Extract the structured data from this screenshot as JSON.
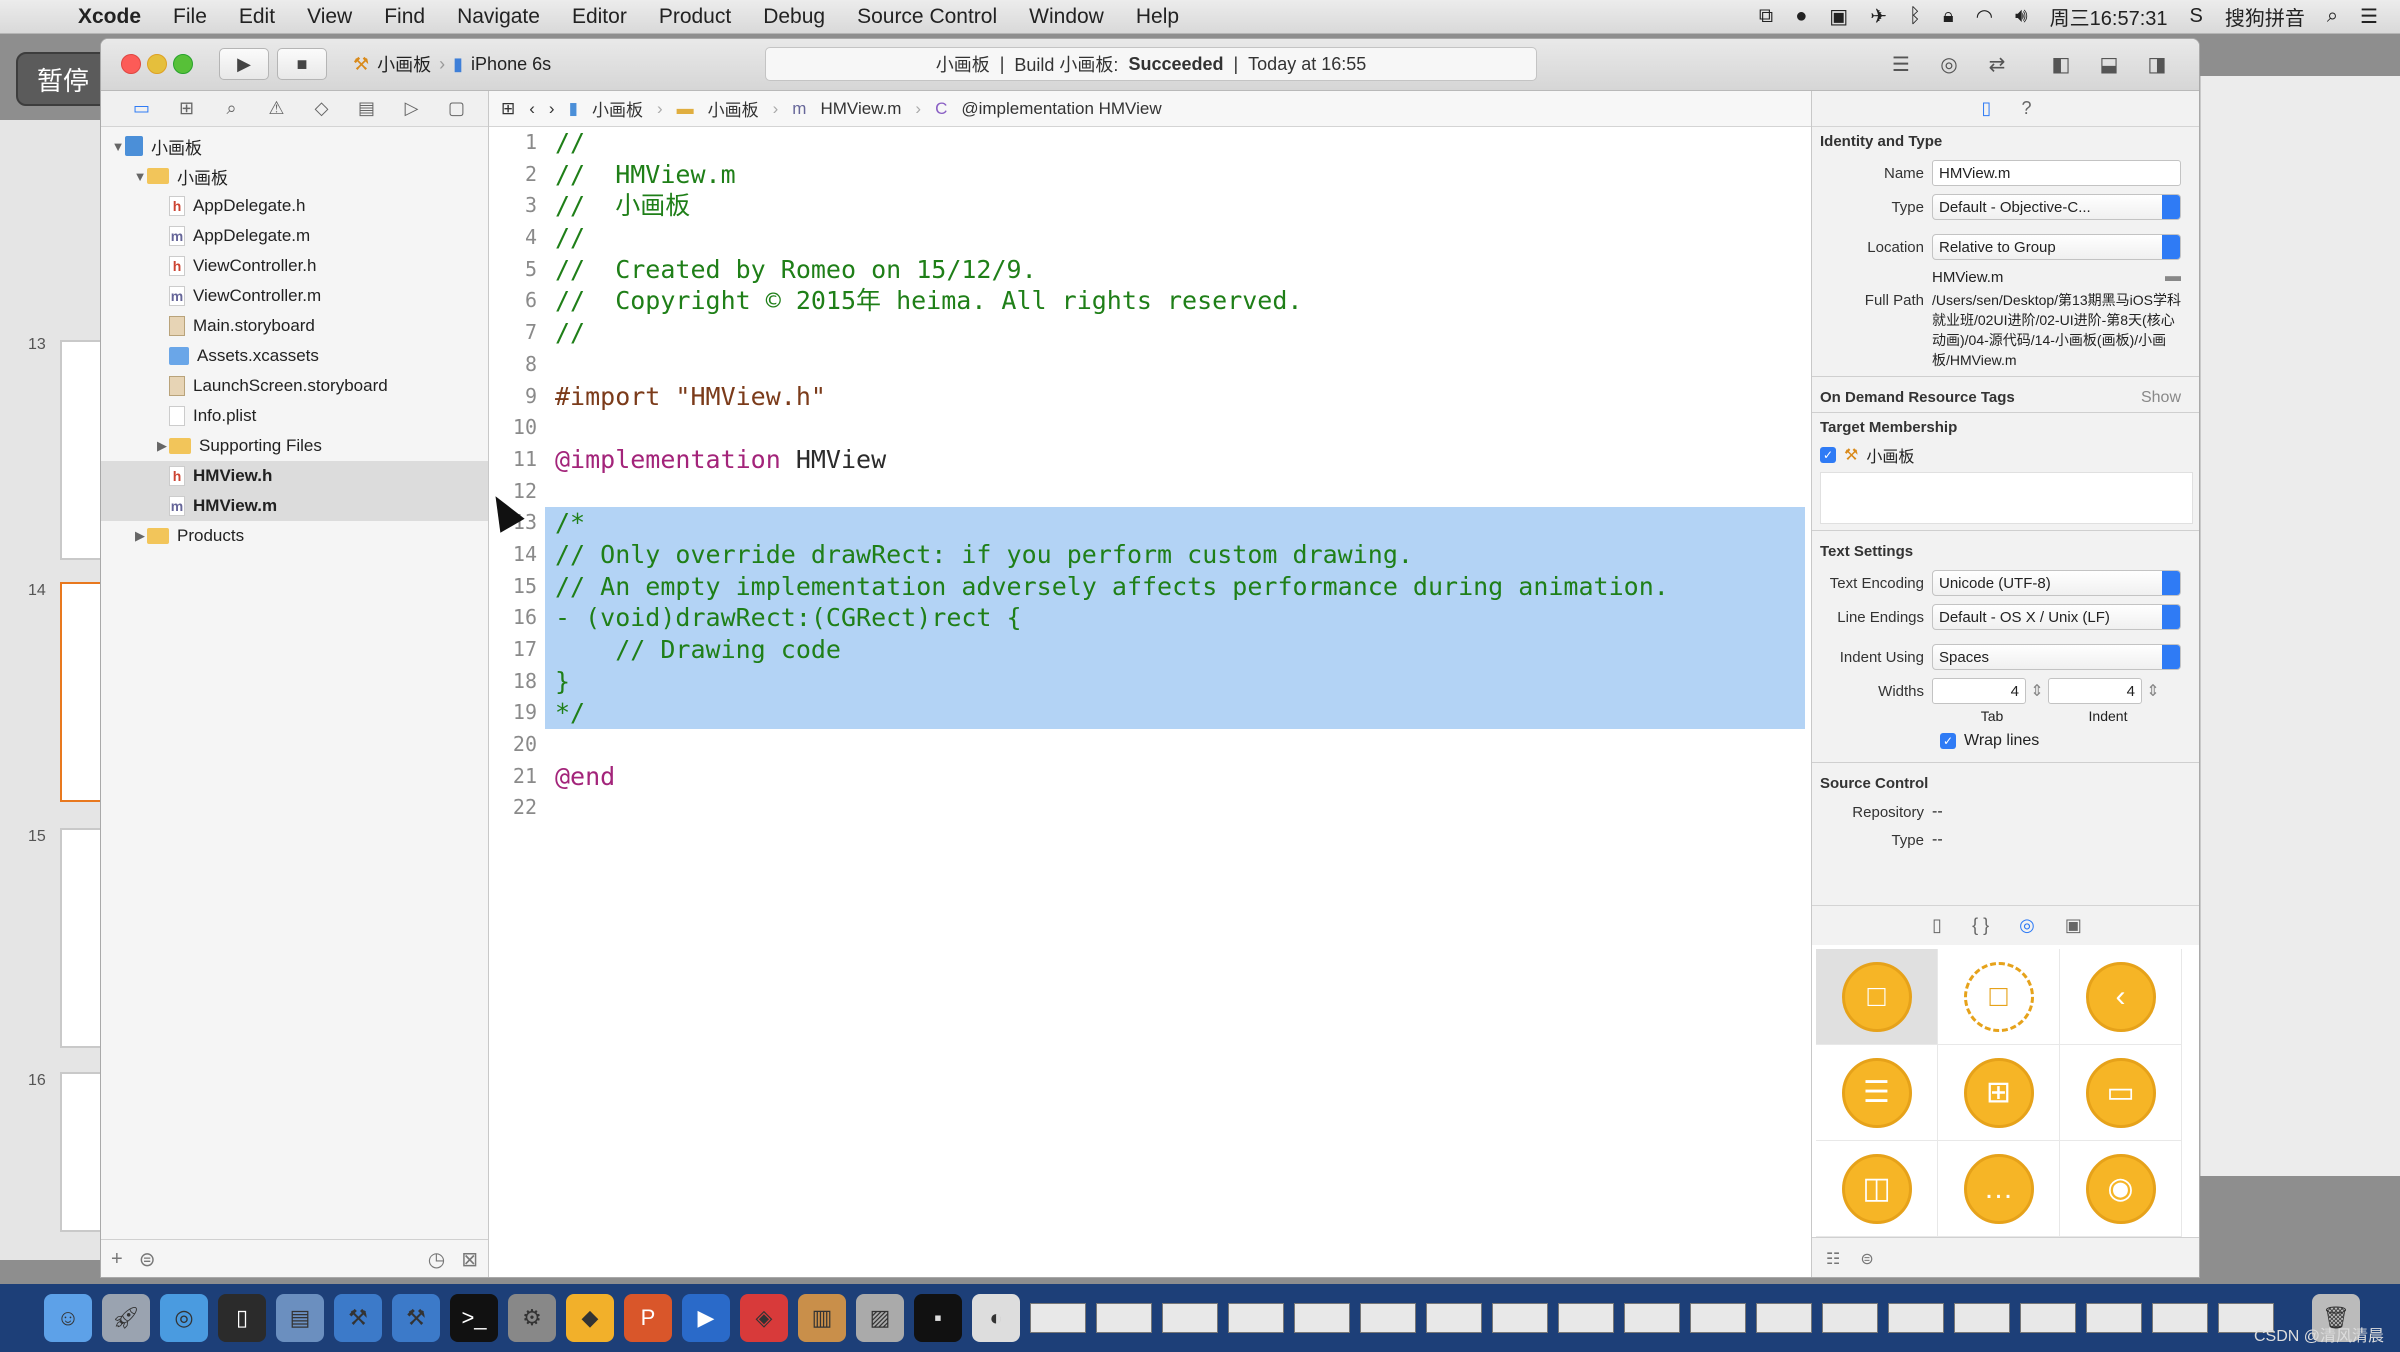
{
  "menubar": {
    "app": "Xcode",
    "items": [
      "File",
      "Edit",
      "View",
      "Find",
      "Navigate",
      "Editor",
      "Product",
      "Debug",
      "Source Control",
      "Window",
      "Help"
    ],
    "clock": "周三16:57:31",
    "ime": "搜狗拼音"
  },
  "overlay": {
    "pause": "暂停"
  },
  "toolbar": {
    "scheme": "小画板",
    "device": "iPhone 6s",
    "activity_project": "小画板",
    "activity_build": "Build 小画板:",
    "activity_status": "Succeeded",
    "activity_time": "Today at 16:55"
  },
  "navigator": {
    "tree": [
      {
        "label": "小画板",
        "type": "proj",
        "indent": 0,
        "disc": "▼"
      },
      {
        "label": "小画板",
        "type": "folder",
        "indent": 1,
        "disc": "▼"
      },
      {
        "label": "AppDelegate.h",
        "type": "h",
        "indent": 2,
        "disc": ""
      },
      {
        "label": "AppDelegate.m",
        "type": "m",
        "indent": 2,
        "disc": ""
      },
      {
        "label": "ViewController.h",
        "type": "h",
        "indent": 2,
        "disc": ""
      },
      {
        "label": "ViewController.m",
        "type": "m",
        "indent": 2,
        "disc": ""
      },
      {
        "label": "Main.storyboard",
        "type": "sb",
        "indent": 2,
        "disc": ""
      },
      {
        "label": "Assets.xcassets",
        "type": "xa",
        "indent": 2,
        "disc": ""
      },
      {
        "label": "LaunchScreen.storyboard",
        "type": "sb",
        "indent": 2,
        "disc": ""
      },
      {
        "label": "Info.plist",
        "type": "pl",
        "indent": 2,
        "disc": ""
      },
      {
        "label": "Supporting Files",
        "type": "folder",
        "indent": 2,
        "disc": "▶"
      },
      {
        "label": "HMView.h",
        "type": "h",
        "indent": 2,
        "disc": "",
        "sel": true
      },
      {
        "label": "HMView.m",
        "type": "m",
        "indent": 2,
        "disc": "",
        "sel": true
      },
      {
        "label": "Products",
        "type": "folder",
        "indent": 1,
        "disc": "▶"
      }
    ]
  },
  "jumpbar": {
    "parts": [
      "小画板",
      "小画板",
      "HMView.m",
      "@implementation HMView"
    ]
  },
  "code": {
    "lines": [
      {
        "n": "1",
        "t": "//",
        "c": "com"
      },
      {
        "n": "2",
        "t": "//  HMView.m",
        "c": "com"
      },
      {
        "n": "3",
        "t": "//  小画板",
        "c": "com"
      },
      {
        "n": "4",
        "t": "//",
        "c": "com"
      },
      {
        "n": "5",
        "t": "//  Created by Romeo on 15/12/9.",
        "c": "com"
      },
      {
        "n": "6",
        "t": "//  Copyright © 2015年 heima. All rights reserved.",
        "c": "com"
      },
      {
        "n": "7",
        "t": "//",
        "c": "com"
      },
      {
        "n": "8",
        "t": "",
        "c": "id"
      },
      {
        "n": "9",
        "t": "#import \"HMView.h\"",
        "c": "pre"
      },
      {
        "n": "10",
        "t": "",
        "c": "id"
      },
      {
        "n": "11",
        "t": "@implementation HMView",
        "c": "kw"
      },
      {
        "n": "12",
        "t": "",
        "c": "id"
      },
      {
        "n": "13",
        "t": "/*",
        "c": "com",
        "hl": true
      },
      {
        "n": "14",
        "t": "// Only override drawRect: if you perform custom drawing.",
        "c": "com",
        "hl": true
      },
      {
        "n": "15",
        "t": "// An empty implementation adversely affects performance during animation.",
        "c": "com",
        "hl": true
      },
      {
        "n": "16",
        "t": "- (void)drawRect:(CGRect)rect {",
        "c": "com",
        "hl": true
      },
      {
        "n": "17",
        "t": "    // Drawing code",
        "c": "com",
        "hl": true
      },
      {
        "n": "18",
        "t": "}",
        "c": "com",
        "hl": true
      },
      {
        "n": "19",
        "t": "*/",
        "c": "com",
        "hl": true
      },
      {
        "n": "20",
        "t": "",
        "c": "id"
      },
      {
        "n": "21",
        "t": "@end",
        "c": "kw"
      },
      {
        "n": "22",
        "t": "",
        "c": "id"
      }
    ]
  },
  "inspector": {
    "identity_title": "Identity and Type",
    "name_label": "Name",
    "name_value": "HMView.m",
    "type_label": "Type",
    "type_value": "Default - Objective-C...",
    "location_label": "Location",
    "location_value": "Relative to Group",
    "location_file": "HMView.m",
    "fullpath_label": "Full Path",
    "fullpath_value": "/Users/sen/Desktop/第13期黑马iOS学科就业班/02UI进阶/02-UI进阶-第8天(核心动画)/04-源代码/14-小画板(画板)/小画板/HMView.m",
    "odr_title": "On Demand Resource Tags",
    "odr_show": "Show",
    "target_title": "Target Membership",
    "target_name": "小画板",
    "text_title": "Text Settings",
    "enc_label": "Text Encoding",
    "enc_value": "Unicode (UTF-8)",
    "le_label": "Line Endings",
    "le_value": "Default - OS X / Unix (LF)",
    "indent_label": "Indent Using",
    "indent_value": "Spaces",
    "widths_label": "Widths",
    "tab_value": "4",
    "indent_width_value": "4",
    "tab_caption": "Tab",
    "indent_caption": "Indent",
    "wrap_label": "Wrap lines",
    "sc_title": "Source Control",
    "repo_label": "Repository",
    "repo_value": "--",
    "sctype_label": "Type",
    "sctype_value": "--"
  },
  "watermark": "CSDN @清风清晨"
}
